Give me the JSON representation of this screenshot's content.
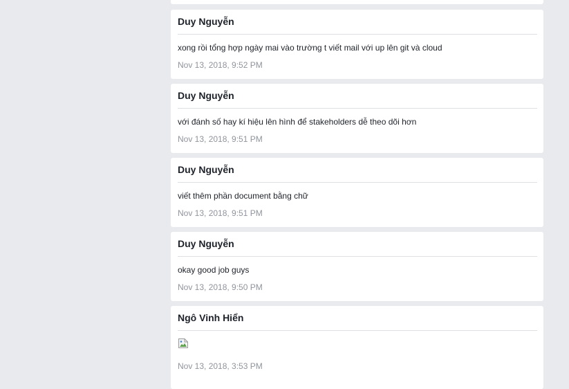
{
  "messages": [
    {
      "author": "Duy Nguyễn",
      "text": "xong rồi tổng hợp ngày mai vào trường t viết mail với up lên git và cloud",
      "time": "Nov 13, 2018, 9:52 PM"
    },
    {
      "author": "Duy Nguyễn",
      "text": "với đánh số hay kí hiệu lên hình để stakeholders dễ theo dõi hơn",
      "time": "Nov 13, 2018, 9:51 PM"
    },
    {
      "author": "Duy Nguyễn",
      "text": "viết thêm phần document bằng chữ",
      "time": "Nov 13, 2018, 9:51 PM"
    },
    {
      "author": "Duy Nguyễn",
      "text": "okay good job guys",
      "time": "Nov 13, 2018, 9:50 PM"
    },
    {
      "author": "Ngô Vinh Hiển",
      "image": "broken-image-icon",
      "time": "Nov 13, 2018, 3:53 PM"
    }
  ]
}
